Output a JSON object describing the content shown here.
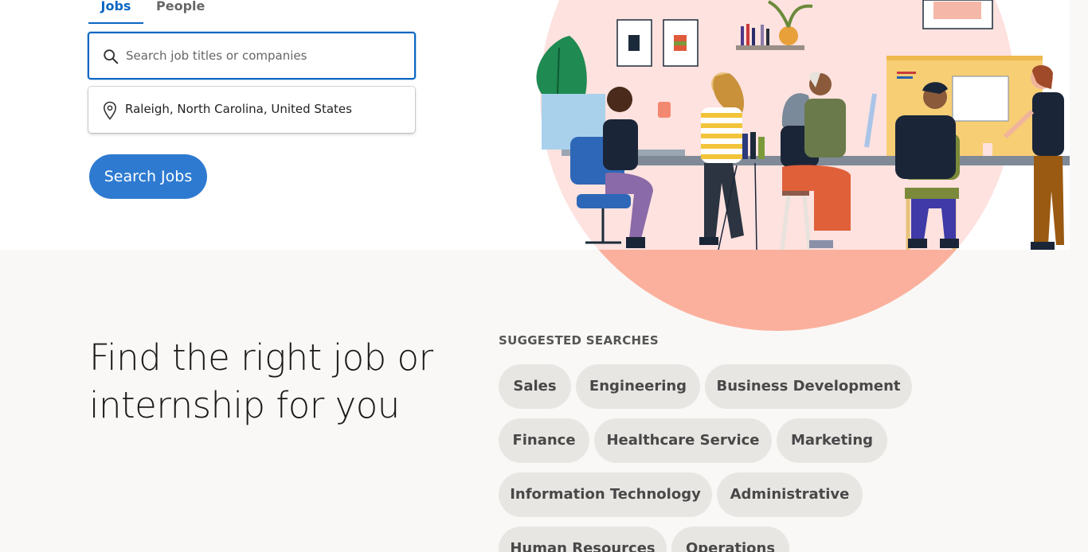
{
  "tabs": {
    "jobs": "Jobs",
    "people": "People"
  },
  "search": {
    "placeholder": "Search job titles or companies",
    "value": ""
  },
  "location": {
    "value": "Raleigh, North Carolina, United States"
  },
  "search_button": "Search Jobs",
  "headline": "Find the right job or internship for you",
  "suggested": {
    "title": "SUGGESTED SEARCHES",
    "items": [
      "Sales",
      "Engineering",
      "Business Development",
      "Finance",
      "Healthcare Service",
      "Marketing",
      "Information Technology",
      "Administrative",
      "Human Resources",
      "Operations"
    ]
  },
  "colors": {
    "accent": "#0a66c2",
    "button": "#2e7ad1",
    "pill_bg": "#e8e6e3",
    "illustration_circle": "#fde2df",
    "illustration_circle_lower": "#fbb09d"
  },
  "icons": {
    "search": "search-icon",
    "location": "location-pin-icon"
  }
}
